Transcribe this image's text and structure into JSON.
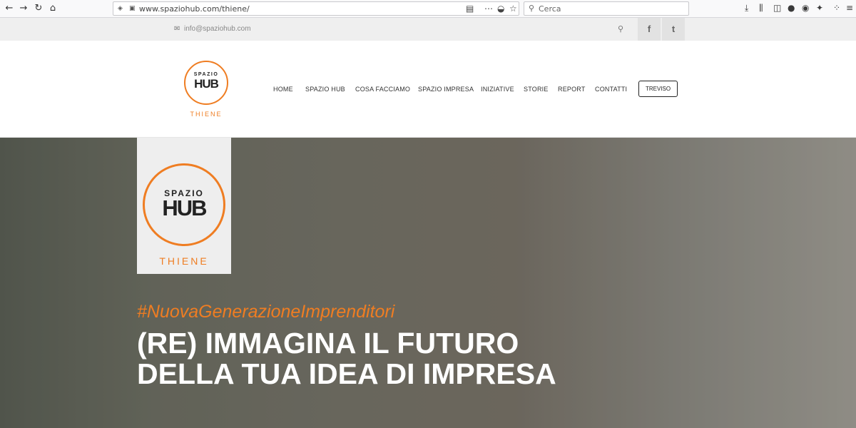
{
  "browser": {
    "url": "www.spaziohub.com/thiene/",
    "search_placeholder": "Cerca",
    "icons": [
      "back-icon",
      "forward-icon",
      "reload-icon",
      "home-icon",
      "shield-icon",
      "lock-icon",
      "reader-icon",
      "more-icon",
      "pocket-icon",
      "star-icon",
      "download-icon",
      "library-icon",
      "sidebar-icon",
      "extension-icon",
      "account-icon",
      "addon-icon",
      "grid-icon",
      "menu-icon"
    ]
  },
  "topbar": {
    "email": "info@spaziohub.com",
    "social": [
      "f",
      "t"
    ]
  },
  "header": {
    "logo": {
      "spazio": "SPAZIO",
      "hub": "HUB",
      "city": "THIENE"
    },
    "nav": [
      "HOME",
      "SPAZIO HUB",
      "COSA FACCIAMO",
      "SPAZIO IMPRESA",
      "INIZIATIVE",
      "STORIE",
      "REPORT",
      "CONTATTI"
    ],
    "cta": "TREVISO"
  },
  "hero": {
    "logo": {
      "spazio": "SPAZIO",
      "hub": "HUB",
      "city": "THIENE"
    },
    "tagline": "#NuovaGenerazioneImprenditori",
    "title": "(RE) IMMAGINA IL FUTURO DELLA TUA IDEA DI IMPRESA"
  },
  "colors": {
    "accent": "#ef7d22",
    "text_dark": "#222222",
    "hero_text": "#ffffff"
  }
}
